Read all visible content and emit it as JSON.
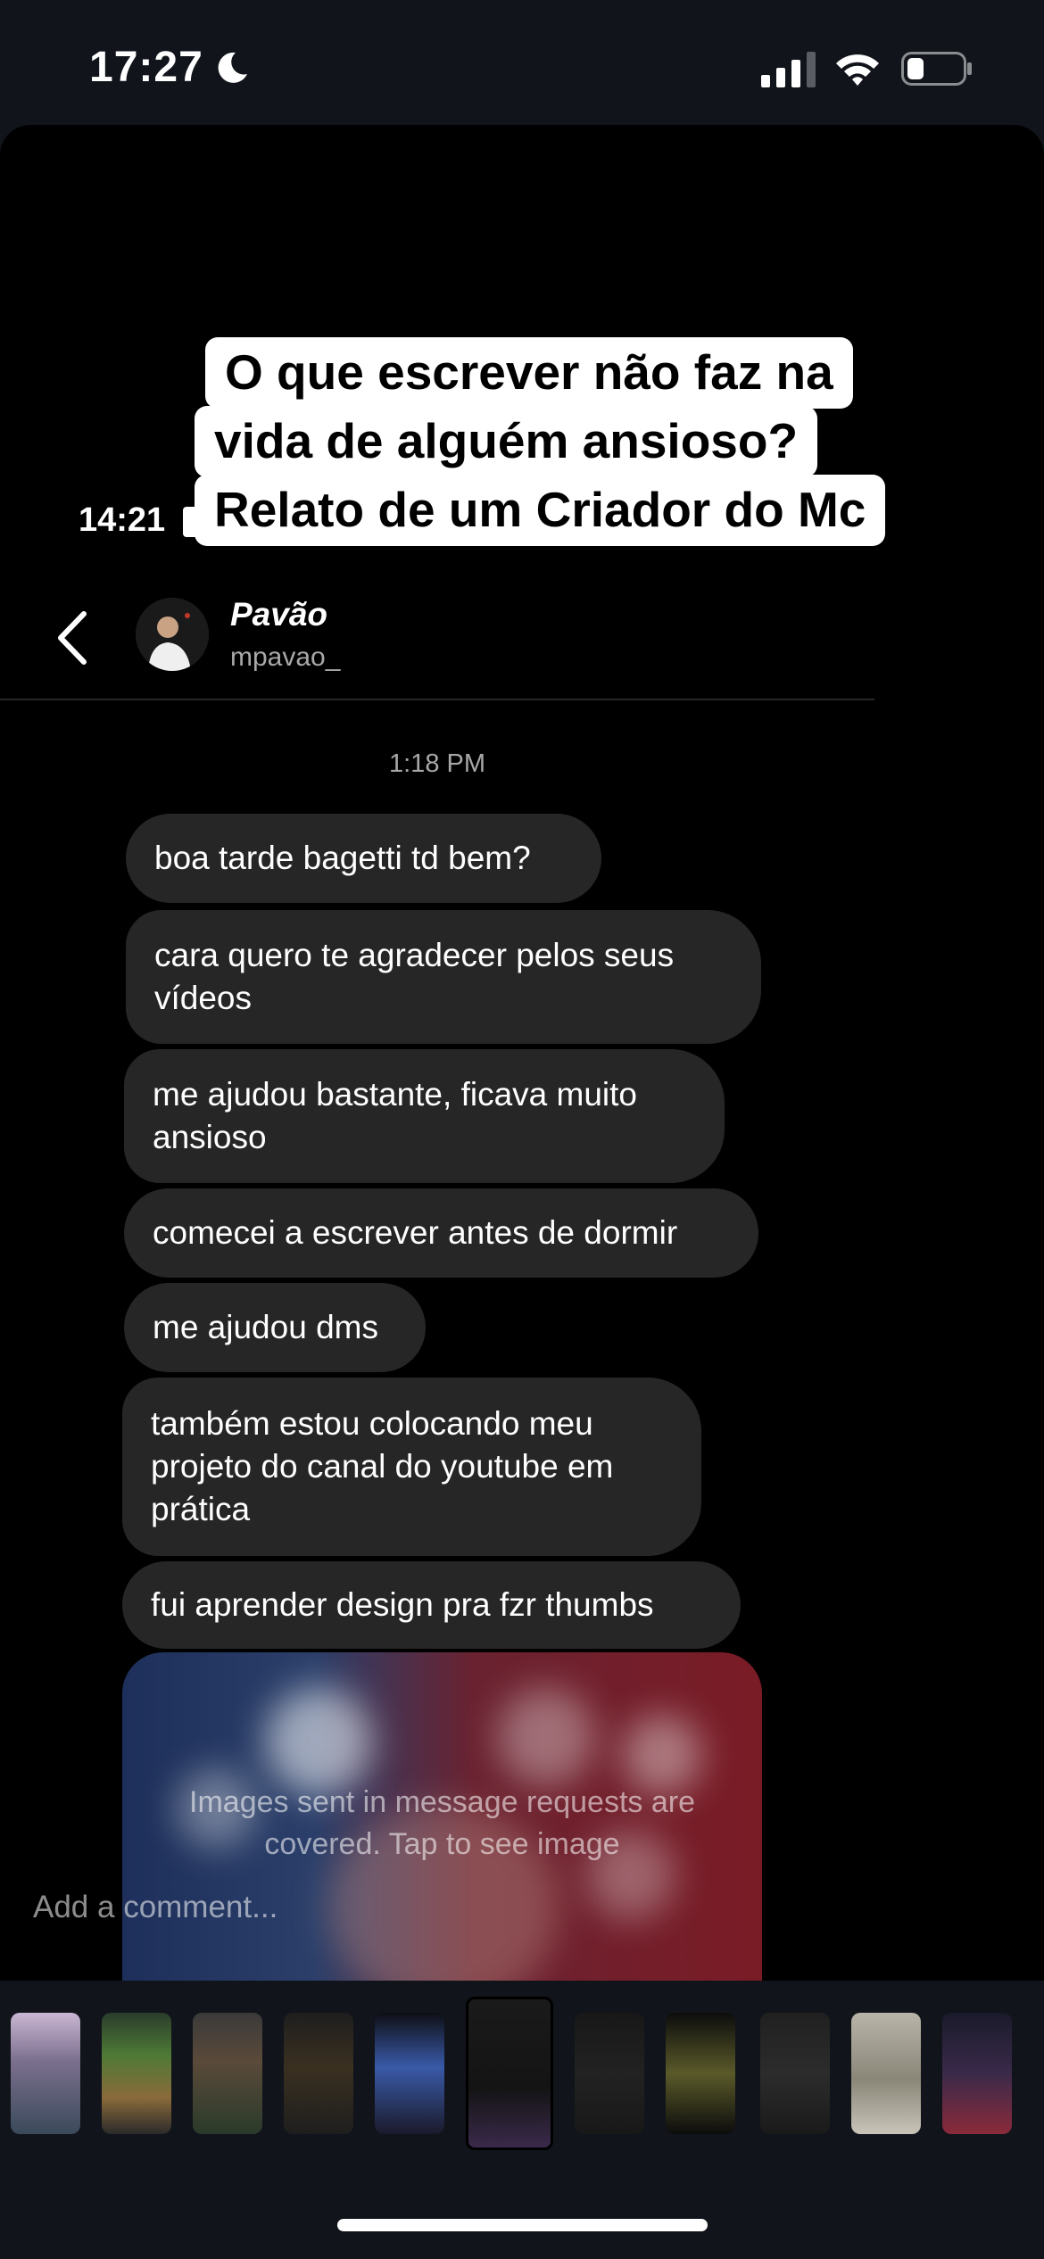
{
  "status_bar": {
    "time": "17:27"
  },
  "story": {
    "caption_lines": [
      "O que escrever não faz na",
      "vida de alguém ansioso?",
      "Relato de um Criador do Mc"
    ],
    "inner_time": "14:21"
  },
  "chat": {
    "contact_name": "Pavão",
    "contact_handle": "mpavao_",
    "timestamp": "1:18 PM",
    "messages": [
      "boa tarde bagetti td bem?",
      "cara quero te agradecer pelos seus\nvídeos",
      "me ajudou bastante, ficava muito\nansioso",
      "comecei a escrever antes de dormir",
      "me ajudou dms",
      "também estou colocando meu\nprojeto do canal do youtube em\nprática",
      "fui aprender design pra fzr thumbs"
    ],
    "covered_image_text": "Images sent in message requests are\ncovered. Tap to see image",
    "comment_placeholder": "Add a comment..."
  },
  "icons": {
    "moon": "moon-icon",
    "signal": "cellular-signal-icon",
    "wifi": "wifi-icon",
    "battery": "battery-icon",
    "back": "chevron-left-icon"
  },
  "colors": {
    "background": "#000000",
    "bubble": "#262626",
    "muted_text": "#a8a8a8"
  }
}
